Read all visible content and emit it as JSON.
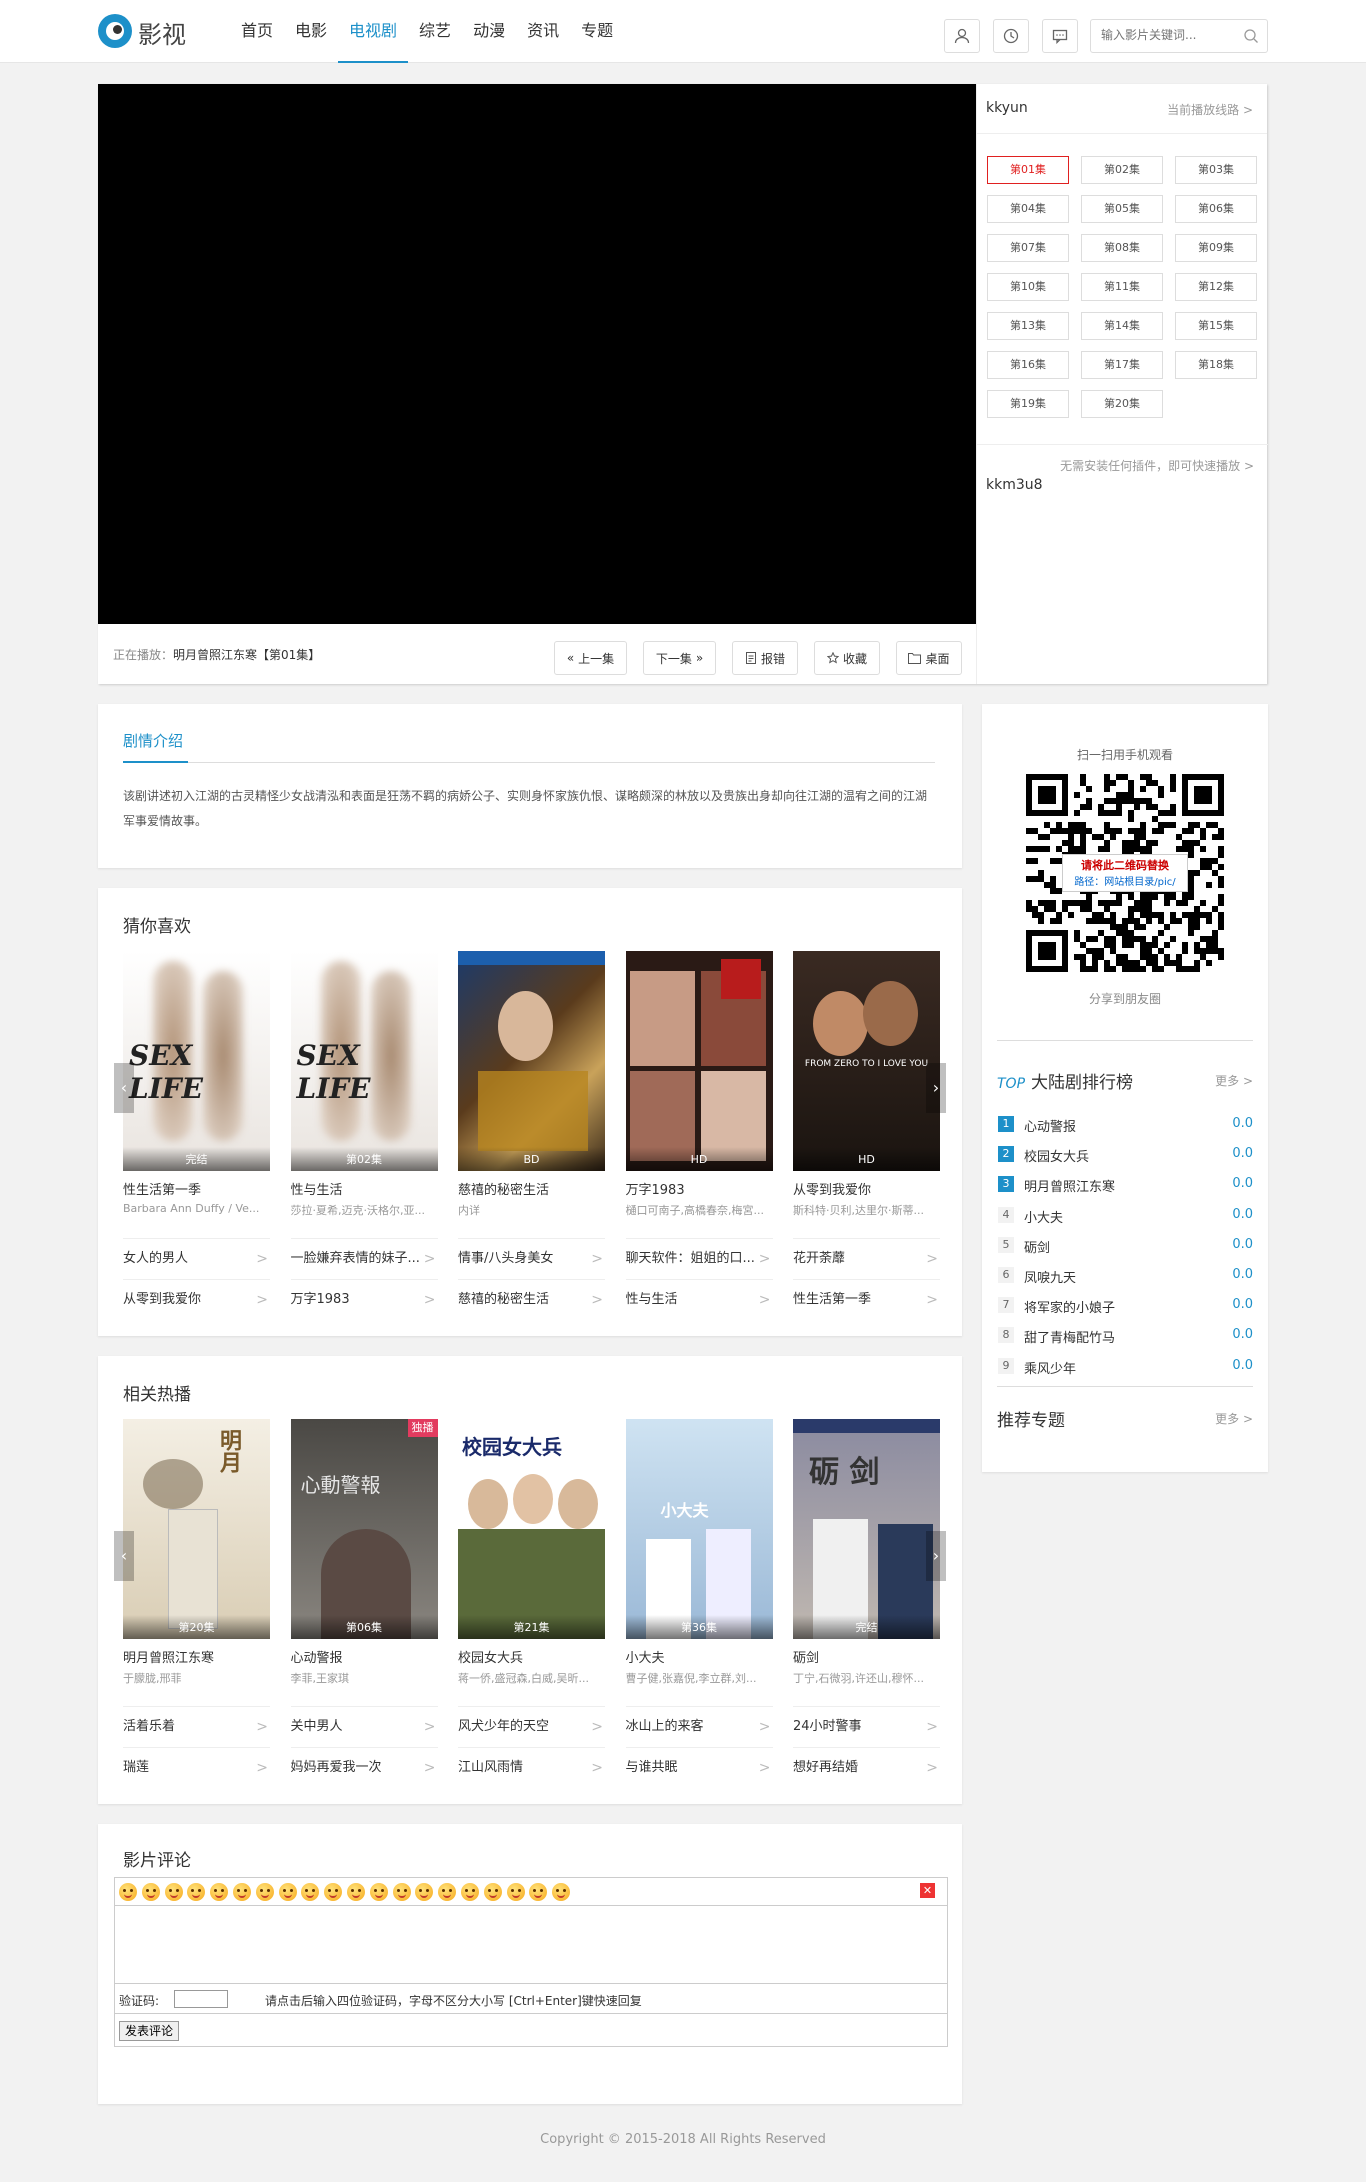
{
  "header": {
    "logo_text": "影视",
    "nav": [
      "首页",
      "电影",
      "电视剧",
      "综艺",
      "动漫",
      "资讯",
      "专题"
    ],
    "active_nav": 2,
    "search_placeholder": "输入影片关键词..."
  },
  "player": {
    "now_prefix": "正在播放：",
    "now_title": "明月曾照江东寒【第01集】",
    "buttons": {
      "prev": "上一集",
      "next": "下一集",
      "report": "报错",
      "fav": "收藏",
      "desktop": "桌面"
    }
  },
  "episodes": {
    "source": "kkyun",
    "line_label": "当前播放线路",
    "items": [
      "第01集",
      "第02集",
      "第03集",
      "第04集",
      "第05集",
      "第06集",
      "第07集",
      "第08集",
      "第09集",
      "第10集",
      "第11集",
      "第12集",
      "第13集",
      "第14集",
      "第15集",
      "第16集",
      "第17集",
      "第18集",
      "第19集",
      "第20集"
    ],
    "current": 0,
    "tip": "无需安装任何插件，即可快速播放",
    "source2": "kkm3u8"
  },
  "intro": {
    "title": "剧情介绍",
    "text": "该剧讲述初入江湖的古灵精怪少女战清泓和表面是狂荡不羁的病娇公子、实则身怀家族仇恨、谋略颇深的林放以及贵族出身却向往江湖的温宥之间的江湖军事爱情故事。"
  },
  "guess": {
    "title": "猜你喜欢",
    "items": [
      {
        "title": "性生活第一季",
        "sub": "Barbara Ann Duffy / Ve...",
        "tag": "完结"
      },
      {
        "title": "性与生活",
        "sub": "莎拉·夏希,迈克·沃格尔,亚...",
        "tag": "第02集"
      },
      {
        "title": "慈禧的秘密生活",
        "sub": "内详",
        "tag": "BD"
      },
      {
        "title": "万字1983",
        "sub": "樋口可南子,高橋春奈,梅宮...",
        "tag": "HD"
      },
      {
        "title": "从零到我爱你",
        "sub": "斯科特·贝利,达里尔·斯蒂...",
        "tag": "HD"
      }
    ],
    "poster_texts": [
      "SEX LIFE",
      "SEX LIFE",
      "",
      "",
      "FROM ZERO TO I LOVE YOU"
    ],
    "links": [
      [
        "女人的男人",
        "一脸嫌弃表情的妹子...",
        "情事/八头身美女",
        "聊天软件：姐姐的口...",
        "花开荼蘼"
      ],
      [
        "从零到我爱你",
        "万字1983",
        "慈禧的秘密生活",
        "性与生活",
        "性生活第一季"
      ]
    ]
  },
  "hot": {
    "title": "相关热播",
    "items": [
      {
        "title": "明月曾照江东寒",
        "sub": "于朦胧,邢菲",
        "tag": "第20集"
      },
      {
        "title": "心动警报",
        "sub": "李菲,王家琪",
        "tag": "第06集"
      },
      {
        "title": "校园女大兵",
        "sub": "蒋一侨,盛冠森,白威,吴昕...",
        "tag": "第21集"
      },
      {
        "title": "小大夫",
        "sub": "曹子健,张嘉倪,李立群,刘...",
        "tag": "第36集"
      },
      {
        "title": "砺剑",
        "sub": "丁宁,石微羽,许还山,穆怀...",
        "tag": "完结"
      }
    ],
    "poster_texts": [
      "",
      "心動警報",
      "校园女大兵",
      "小大夫",
      "砺 剑"
    ],
    "exclusive_badge": "独播",
    "links": [
      [
        "活着乐着",
        "关中男人",
        "风犬少年的天空",
        "冰山上的来客",
        "24小时警事"
      ],
      [
        "瑞莲",
        "妈妈再爱我一次",
        "江山风雨情",
        "与谁共眠",
        "想好再结婚"
      ]
    ]
  },
  "side": {
    "qr_tip": "扫一扫用手机观看",
    "qr_overlay_1": "请将此二维码替换",
    "qr_overlay_2": "路径：网站根目录/pic/",
    "share": "分享到朋友圈",
    "rank_top": "TOP",
    "rank_title": "大陆剧排行榜",
    "more": "更多",
    "rank": [
      {
        "no": "1",
        "name": "心动警报",
        "score": "0.0"
      },
      {
        "no": "2",
        "name": "校园女大兵",
        "score": "0.0"
      },
      {
        "no": "3",
        "name": "明月曾照江东寒",
        "score": "0.0"
      },
      {
        "no": "4",
        "name": "小大夫",
        "score": "0.0"
      },
      {
        "no": "5",
        "name": "砺剑",
        "score": "0.0"
      },
      {
        "no": "6",
        "name": "凤唳九天",
        "score": "0.0"
      },
      {
        "no": "7",
        "name": "将军家的小娘子",
        "score": "0.0"
      },
      {
        "no": "8",
        "name": "甜了青梅配竹马",
        "score": "0.0"
      },
      {
        "no": "9",
        "name": "乘风少年",
        "score": "0.0"
      }
    ],
    "topic_title": "推荐专题"
  },
  "comments": {
    "title": "影片评论",
    "verify_label": "验证码:",
    "verify_tip": "请点击后输入四位验证码，字母不区分大小写 [Ctrl+Enter]键快速回复",
    "submit": "发表评论",
    "close": "✕"
  },
  "footer": {
    "copyright": "Copyright © 2015-2018 All Rights Reserved"
  },
  "colors": {
    "accent": "#1d90c9",
    "current_ep": "#e02020"
  }
}
